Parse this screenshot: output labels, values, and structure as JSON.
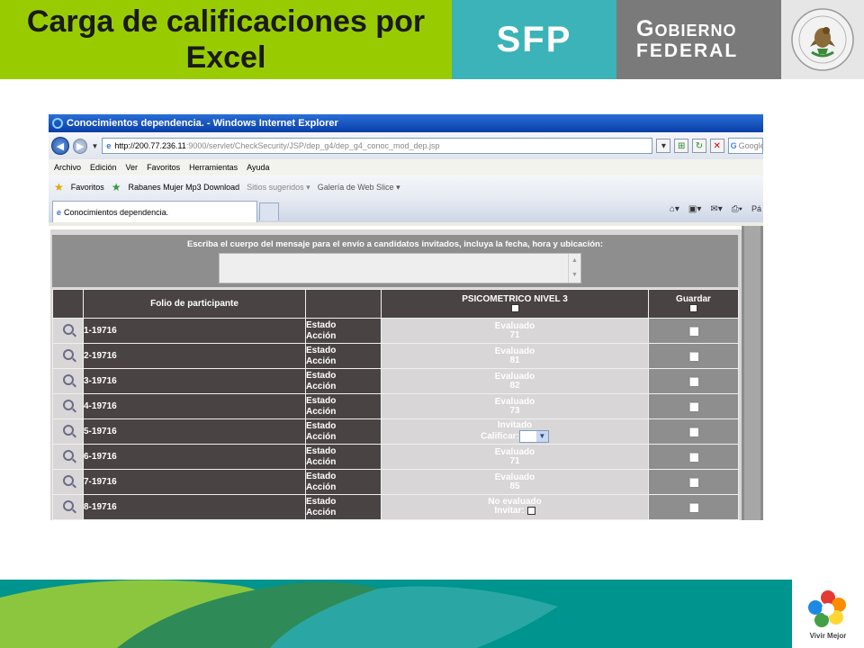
{
  "slide": {
    "title_line1": "Carga de calificaciones por",
    "title_line2": "Excel",
    "brand_sfp": "SFP",
    "brand_gobierno_l1": "Gobierno",
    "brand_gobierno_l2": "federal",
    "footer_logo_label": "Vivir Mejor",
    "colors": {
      "title_bg": "#99cc00",
      "sfp_bg": "#3bb3b8",
      "gobierno_bg": "#7a7a7a",
      "footer_teal": "#00948f",
      "footer_green": "#8cc63f"
    }
  },
  "browser": {
    "window_title": "Conocimientos dependencia. - Windows Internet Explorer",
    "url_host": "http://200.77.236.11",
    "url_path": ":9000/servlet/CheckSecurity/JSP/dep_g4/dep_g4_conoc_mod_dep.jsp",
    "search_placeholder": "Google",
    "menu": [
      "Archivo",
      "Edición",
      "Ver",
      "Favoritos",
      "Herramientas",
      "Ayuda"
    ],
    "favorites_label": "Favoritos",
    "favorites_links": [
      "Rabanes Mujer Mp3 Download",
      "Sitios sugeridos ▾",
      "Galería de Web Slice ▾"
    ],
    "tab_label": "Conocimientos dependencia.",
    "tools_page_label": "Pá"
  },
  "page": {
    "message_label": "Escriba el cuerpo del mensaje para el envío a candidatos invitados, incluya la fecha, hora y ubicación:",
    "headers": {
      "folio": "Folio de participante",
      "exam": "PSICOMETRICO NIVEL 3",
      "guardar": "Guardar"
    },
    "rows": [
      {
        "folio": "1-19716",
        "estado": "Estado",
        "accion": "Acción",
        "status": "Evaluado",
        "score": "71"
      },
      {
        "folio": "2-19716",
        "estado": "Estado",
        "accion": "Acción",
        "status": "Evaluado",
        "score": "81"
      },
      {
        "folio": "3-19716",
        "estado": "Estado",
        "accion": "Acción",
        "status": "Evaluado",
        "score": "82"
      },
      {
        "folio": "4-19716",
        "estado": "Estado",
        "accion": "Acción",
        "status": "Evaluado",
        "score": "73"
      },
      {
        "folio": "5-19716",
        "estado": "Estado",
        "accion": "Acción",
        "status": "Invitado",
        "action_label": "Calificar:"
      },
      {
        "folio": "6-19716",
        "estado": "Estado",
        "accion": "Acción",
        "status": "Evaluado",
        "score": "71"
      },
      {
        "folio": "7-19716",
        "estado": "Estado",
        "accion": "Acción",
        "status": "Evaluado",
        "score": "85"
      },
      {
        "folio": "8-19716",
        "estado": "Estado",
        "accion": "Acción",
        "status": "No evaluado",
        "action_label": "Invitar:"
      }
    ]
  }
}
